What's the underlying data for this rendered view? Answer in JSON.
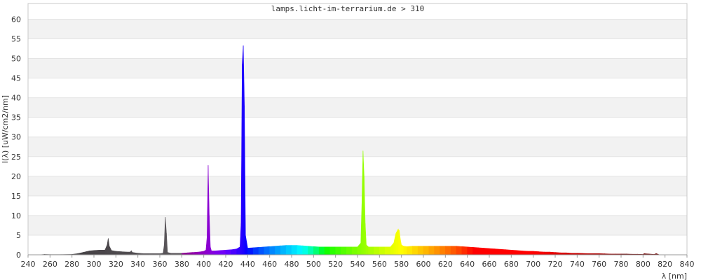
{
  "chart_data": {
    "type": "area",
    "title": "lamps.licht-im-terrarium.de > 310",
    "xlabel": "λ [nm]",
    "ylabel": "I(λ) [uW/cm2/nm]",
    "xlim": [
      240,
      840
    ],
    "ylim": [
      0,
      64
    ],
    "x_ticks": [
      240,
      260,
      280,
      300,
      320,
      340,
      360,
      380,
      400,
      420,
      440,
      460,
      480,
      500,
      520,
      540,
      560,
      580,
      600,
      620,
      640,
      660,
      680,
      700,
      720,
      740,
      760,
      780,
      800,
      820,
      840
    ],
    "y_ticks": [
      0,
      5,
      10,
      15,
      20,
      25,
      30,
      35,
      40,
      45,
      50,
      55,
      60
    ],
    "grid": true,
    "legend": "none",
    "series": [
      {
        "x": [
          250,
          255,
          260,
          270,
          280,
          285,
          290,
          293,
          296,
          300,
          305,
          310,
          312,
          313,
          314,
          316,
          320,
          325,
          330,
          333,
          334,
          335,
          340,
          345,
          350,
          355,
          360,
          363,
          364,
          365,
          366,
          367,
          370,
          375,
          380,
          385,
          390,
          395,
          400,
          402,
          403,
          404,
          405,
          406,
          407,
          410,
          415,
          420,
          425,
          430,
          433,
          434,
          435,
          436,
          437,
          438,
          440,
          445,
          450,
          455,
          460,
          465,
          470,
          475,
          480,
          485,
          490,
          495,
          500,
          505,
          510,
          515,
          520,
          525,
          530,
          535,
          540,
          543,
          544,
          545,
          546,
          547,
          548,
          550,
          555,
          560,
          565,
          570,
          573,
          575,
          577,
          578,
          579,
          580,
          582,
          585,
          590,
          595,
          600,
          605,
          610,
          615,
          620,
          625,
          630,
          635,
          640,
          645,
          650,
          655,
          660,
          665,
          670,
          675,
          680,
          685,
          690,
          695,
          700,
          705,
          710,
          715,
          720,
          725,
          730,
          735,
          740,
          745,
          750,
          755,
          760,
          765,
          770,
          775,
          780,
          785,
          790,
          795,
          800,
          801,
          805,
          810,
          811,
          812,
          813,
          815
        ],
        "y": [
          0,
          0.1,
          0.05,
          0.05,
          0.1,
          0.3,
          0.6,
          0.8,
          1.0,
          1.1,
          1.2,
          1.2,
          2.5,
          4.2,
          2.2,
          1.1,
          0.9,
          0.8,
          0.7,
          0.7,
          1.0,
          0.6,
          0.4,
          0.3,
          0.3,
          0.3,
          0.3,
          0.4,
          2.5,
          9.6,
          5.5,
          0.6,
          0.4,
          0.4,
          0.4,
          0.5,
          0.6,
          0.7,
          0.9,
          1.2,
          4.5,
          22.8,
          10.0,
          2.0,
          1.0,
          1.0,
          1.1,
          1.2,
          1.3,
          1.5,
          2.0,
          8.0,
          48.5,
          53.3,
          38.0,
          5.0,
          1.7,
          1.8,
          1.9,
          2.0,
          2.1,
          2.2,
          2.3,
          2.4,
          2.4,
          2.4,
          2.3,
          2.2,
          2.1,
          2.0,
          2.0,
          2.0,
          2.0,
          2.0,
          2.0,
          2.0,
          2.0,
          3.0,
          13.0,
          26.5,
          20.0,
          8.0,
          2.5,
          2.0,
          2.0,
          2.0,
          2.0,
          2.0,
          3.0,
          5.5,
          6.5,
          6.2,
          4.0,
          2.5,
          2.2,
          2.1,
          2.2,
          2.2,
          2.2,
          2.2,
          2.2,
          2.2,
          2.2,
          2.2,
          2.2,
          2.1,
          2.0,
          1.9,
          1.8,
          1.7,
          1.6,
          1.5,
          1.4,
          1.3,
          1.2,
          1.1,
          1.0,
          0.9,
          0.9,
          0.8,
          0.7,
          0.7,
          0.6,
          0.5,
          0.5,
          0.4,
          0.4,
          0.35,
          0.3,
          0.3,
          0.3,
          0.25,
          0.2,
          0.2,
          0.2,
          0.2,
          0.15,
          0.15,
          0.1,
          0.3,
          0.2,
          0.1,
          0.2,
          0.3,
          0.2,
          0
        ]
      }
    ]
  }
}
